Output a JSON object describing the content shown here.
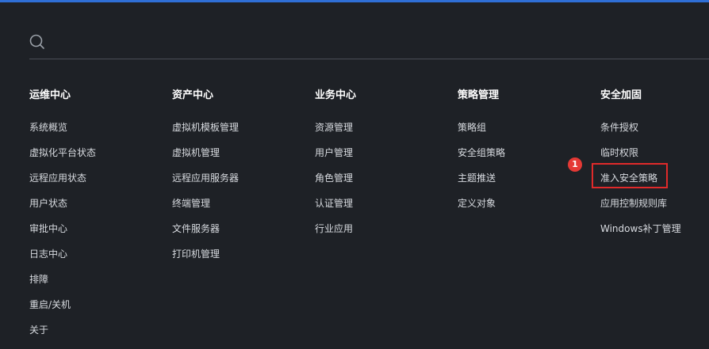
{
  "search": {
    "placeholder": ""
  },
  "columns": [
    {
      "title": "运维中心",
      "items": [
        "系统概览",
        "虚拟化平台状态",
        "远程应用状态",
        "用户状态",
        "审批中心",
        "日志中心",
        "排障",
        "重启/关机",
        "关于"
      ]
    },
    {
      "title": "资产中心",
      "items": [
        "虚拟机模板管理",
        "虚拟机管理",
        "远程应用服务器",
        "终端管理",
        "文件服务器",
        "打印机管理"
      ]
    },
    {
      "title": "业务中心",
      "items": [
        "资源管理",
        "用户管理",
        "角色管理",
        "认证管理",
        "行业应用"
      ]
    },
    {
      "title": "策略管理",
      "items": [
        "策略组",
        "安全组策略",
        "主题推送",
        "定义对象"
      ]
    },
    {
      "title": "安全加固",
      "items": [
        "条件授权",
        "临时权限",
        "准入安全策略",
        "应用控制规则库",
        "Windows补丁管理"
      ]
    }
  ],
  "annotation": {
    "badge": "1"
  },
  "colors": {
    "background": "#1e2126",
    "accent": "#2f6fd6",
    "highlight": "#e02a2a"
  }
}
